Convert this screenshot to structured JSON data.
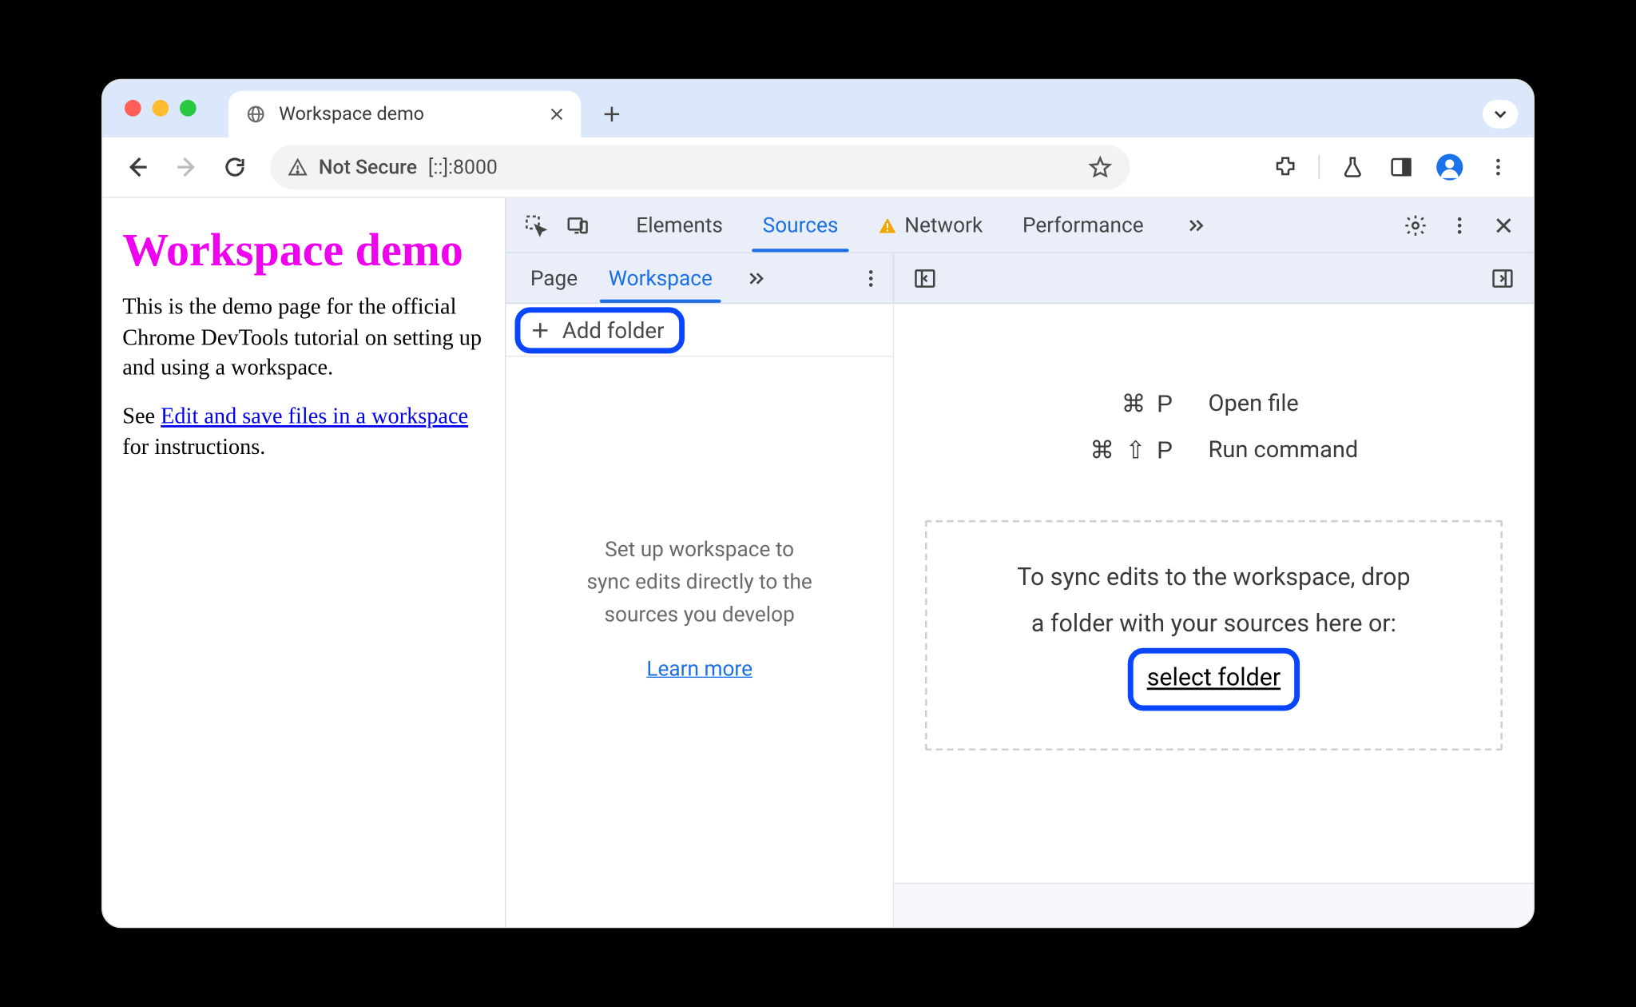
{
  "browser": {
    "tab_title": "Workspace demo",
    "not_secure": "Not Secure",
    "url": "[::]:8000"
  },
  "page": {
    "h1": "Workspace demo",
    "p1": "This is the demo page for the official Chrome DevTools tutorial on setting up and using a workspace.",
    "p2a": "See ",
    "link": "Edit and save files in a workspace",
    "p2b": " for instructions."
  },
  "devtools": {
    "tabs": {
      "elements": "Elements",
      "sources": "Sources",
      "network": "Network",
      "performance": "Performance"
    },
    "sources_tabs": {
      "page": "Page",
      "workspace": "Workspace"
    },
    "add_folder": "Add folder",
    "nav_help_l1": "Set up workspace to",
    "nav_help_l2": "sync edits directly to the",
    "nav_help_l3": "sources you develop",
    "learn_more": "Learn more",
    "shortcuts": {
      "open_keys": "⌘ P",
      "open_label": "Open file",
      "cmd_keys": "⌘ ⇧ P",
      "cmd_label": "Run command"
    },
    "drop_l1": "To sync edits to the workspace, drop",
    "drop_l2": "a folder with your sources here or:",
    "select_folder": "select folder"
  }
}
